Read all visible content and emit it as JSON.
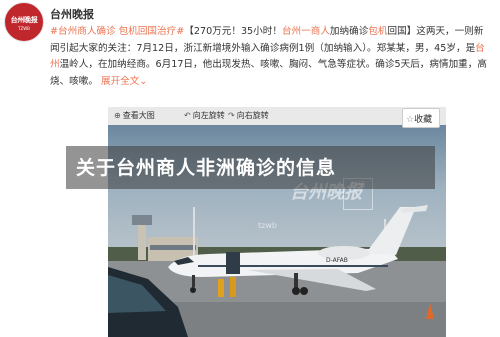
{
  "account": {
    "name": "台州晚报",
    "avatar_logo": "台州晚报",
    "avatar_sub": "TZWB"
  },
  "post": {
    "topic_1": "#台州商人确诊 包机回国治疗#",
    "headline": "【270万元！35小时！",
    "headline_link": "台州一商人",
    "headline_mid": "加纳确诊",
    "headline_link2": "包机",
    "headline_end": "回国】",
    "body_1": "这两天，一则新闻引起大家的关注：7月12日，浙江新增境外输入确诊病例1例（加纳输入）。郑某某，男，45岁，是",
    "body_link": "台州",
    "body_2": "温岭人，在加纳经商。6月17日，他出现发热、咳嗽、胸闷、气急等症状。确诊5天后，病情加重，高烧、咳嗽。",
    "expand": "展开全文",
    "expand_icon": "chevron-down-icon"
  },
  "toolbar": {
    "view_large": "查看大图",
    "rotate_left": "向左旋转",
    "rotate_right": "向右旋转"
  },
  "collect": {
    "label": "收藏"
  },
  "banner": {
    "title": "关于台州商人非洲确诊的信息"
  },
  "watermark": {
    "logo": "台州晚报",
    "sub": "tzwb",
    "stamp": "新闻"
  },
  "aircraft": {
    "registration": "D-AFAB"
  },
  "colors": {
    "link": "#eb7350",
    "brand_red": "#c0272d",
    "banner_bg": "#3c3c3c"
  }
}
